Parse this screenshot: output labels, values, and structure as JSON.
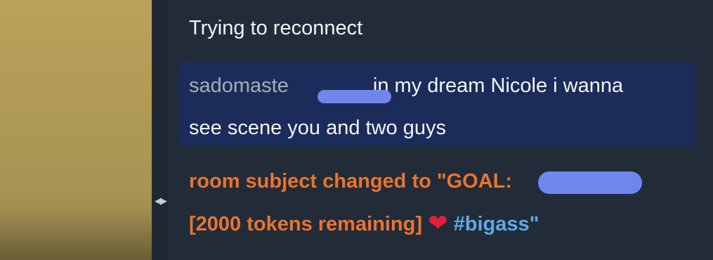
{
  "chat": {
    "system_message": "Trying to reconnect",
    "message": {
      "username": "sadomaste",
      "text_line1": "in my dream Nicole i wanna",
      "text_line2": "see scene you and two guys"
    },
    "notice": {
      "line1_prefix": "room subject changed to \"GOAL: ",
      "line2": "[2000 tokens remaining]",
      "heart_icon": "heart-icon",
      "hashtag": "#bigass\""
    }
  },
  "colors": {
    "chat_background": "#222b38",
    "highlight_background": "#1b2c5b",
    "notice_orange": "#e8742f",
    "hashtag_blue": "#5da8e5",
    "redaction_blue": "#6f86ef",
    "heart_red": "#e31d3b"
  }
}
